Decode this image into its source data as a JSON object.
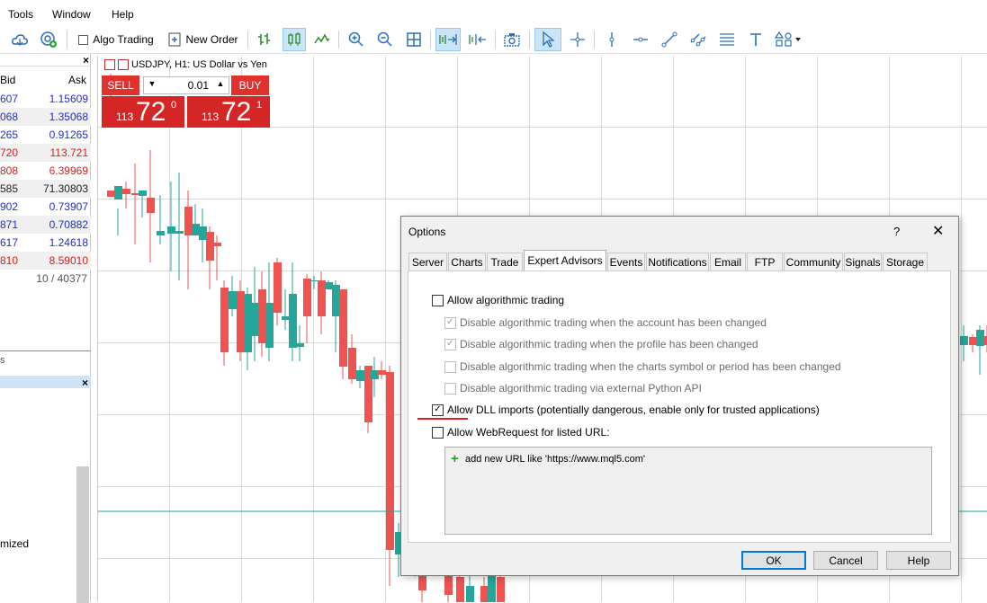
{
  "menu": [
    "Tools",
    "Window",
    "Help"
  ],
  "toolbar": {
    "algo_trading": "Algo Trading",
    "new_order": "New Order"
  },
  "market_watch": {
    "col_bid": "Bid",
    "col_ask": "Ask",
    "rows": [
      {
        "bid": "607",
        "ask": "1.15609",
        "color": "blue"
      },
      {
        "bid": "068",
        "ask": "1.35068",
        "color": "blue"
      },
      {
        "bid": "265",
        "ask": "0.91265",
        "color": "blue"
      },
      {
        "bid": "720",
        "ask": "113.721",
        "color": "red"
      },
      {
        "bid": "808",
        "ask": "6.39969",
        "color": "red"
      },
      {
        "bid": "585",
        "ask": "71.30803",
        "color": "black"
      },
      {
        "bid": "902",
        "ask": "0.73907",
        "color": "blue"
      },
      {
        "bid": "871",
        "ask": "0.70882",
        "color": "blue"
      },
      {
        "bid": "617",
        "ask": "1.24618",
        "color": "blue"
      },
      {
        "bid": "810",
        "ask": "8.59010",
        "color": "red"
      }
    ],
    "count": "10 / 40377"
  },
  "navigator": {
    "tab_fragment": "s",
    "item_fragment": "mized"
  },
  "chart": {
    "title": "USDJPY, H1:  US Dollar vs Yen",
    "sell_label": "SELL",
    "buy_label": "BUY",
    "lot": "0.01",
    "sell_small": "113",
    "sell_big": "72",
    "sell_sup": "0",
    "buy_small": "113",
    "buy_big": "72",
    "buy_sup": "1"
  },
  "dialog": {
    "title": "Options",
    "help": "?",
    "tabs": [
      "Server",
      "Charts",
      "Trade",
      "Expert Advisors",
      "Events",
      "Notifications",
      "Email",
      "FTP",
      "Community",
      "Signals",
      "Storage"
    ],
    "active_tab": "Expert Advisors",
    "options": [
      {
        "label": "Allow algorithmic trading",
        "checked": false,
        "disabled": false
      },
      {
        "label": "Disable algorithmic trading when the account has been changed",
        "checked": true,
        "disabled": true
      },
      {
        "label": "Disable algorithmic trading when the profile has been changed",
        "checked": true,
        "disabled": true
      },
      {
        "label": "Disable algorithmic trading when the charts symbol or period has been changed",
        "checked": false,
        "disabled": true
      },
      {
        "label": "Disable algorithmic trading via external Python API",
        "checked": false,
        "disabled": true
      },
      {
        "label": "Allow DLL imports (potentially dangerous, enable only for trusted applications)",
        "checked": true,
        "disabled": false
      },
      {
        "label": "Allow WebRequest for listed URL:",
        "checked": false,
        "disabled": false
      }
    ],
    "url_placeholder": "add new URL like 'https://www.mql5.com'",
    "ok": "OK",
    "cancel": "Cancel",
    "help_btn": "Help"
  }
}
